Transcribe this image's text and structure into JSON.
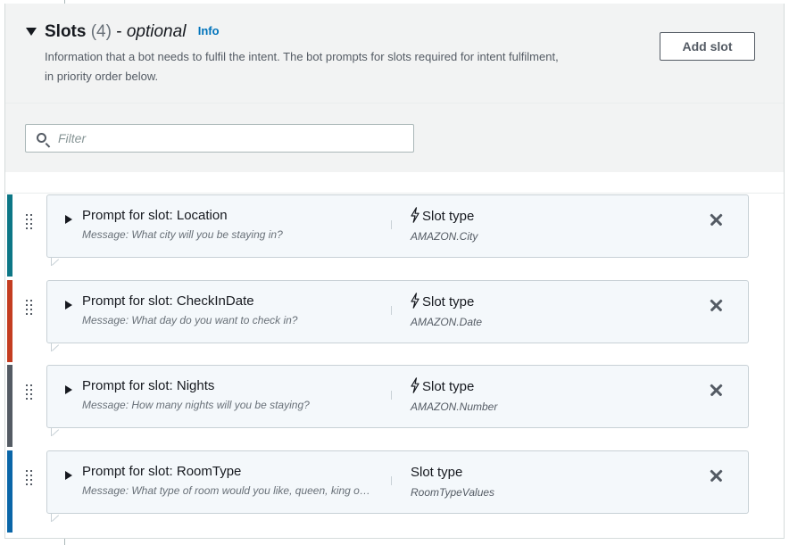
{
  "section": {
    "title": "Slots",
    "count": "(4)",
    "dash": "-",
    "optional": "optional",
    "info": "Info",
    "description": "Information that a bot needs to fulfil the intent. The bot prompts for slots required for intent fulfilment, in priority order below.",
    "add_button": "Add slot"
  },
  "filter": {
    "placeholder": "Filter",
    "value": ""
  },
  "slots": [
    {
      "title": "Prompt for slot: Location",
      "message": "Message: What city will you be staying in?",
      "type_label": "Slot type",
      "type_value": "AMAZON.City",
      "builtin": true,
      "color": "#0d7786"
    },
    {
      "title": "Prompt for slot: CheckInDate",
      "message": "Message: What day do you want to check in?",
      "type_label": "Slot type",
      "type_value": "AMAZON.Date",
      "builtin": true,
      "color": "#c43d21"
    },
    {
      "title": "Prompt for slot: Nights",
      "message": "Message: How many nights will you be staying?",
      "type_label": "Slot type",
      "type_value": "AMAZON.Number",
      "builtin": true,
      "color": "#545b64"
    },
    {
      "title": "Prompt for slot: RoomType",
      "message": "Message: What type of room would you like, queen, king or deluxe?",
      "type_label": "Slot type",
      "type_value": "RoomTypeValues",
      "builtin": false,
      "color": "#0a66a8"
    }
  ],
  "icons": {
    "bolt": "lightning-bolt-icon",
    "close": "close-icon",
    "grip": "drag-handle-icon",
    "search": "search-icon"
  }
}
